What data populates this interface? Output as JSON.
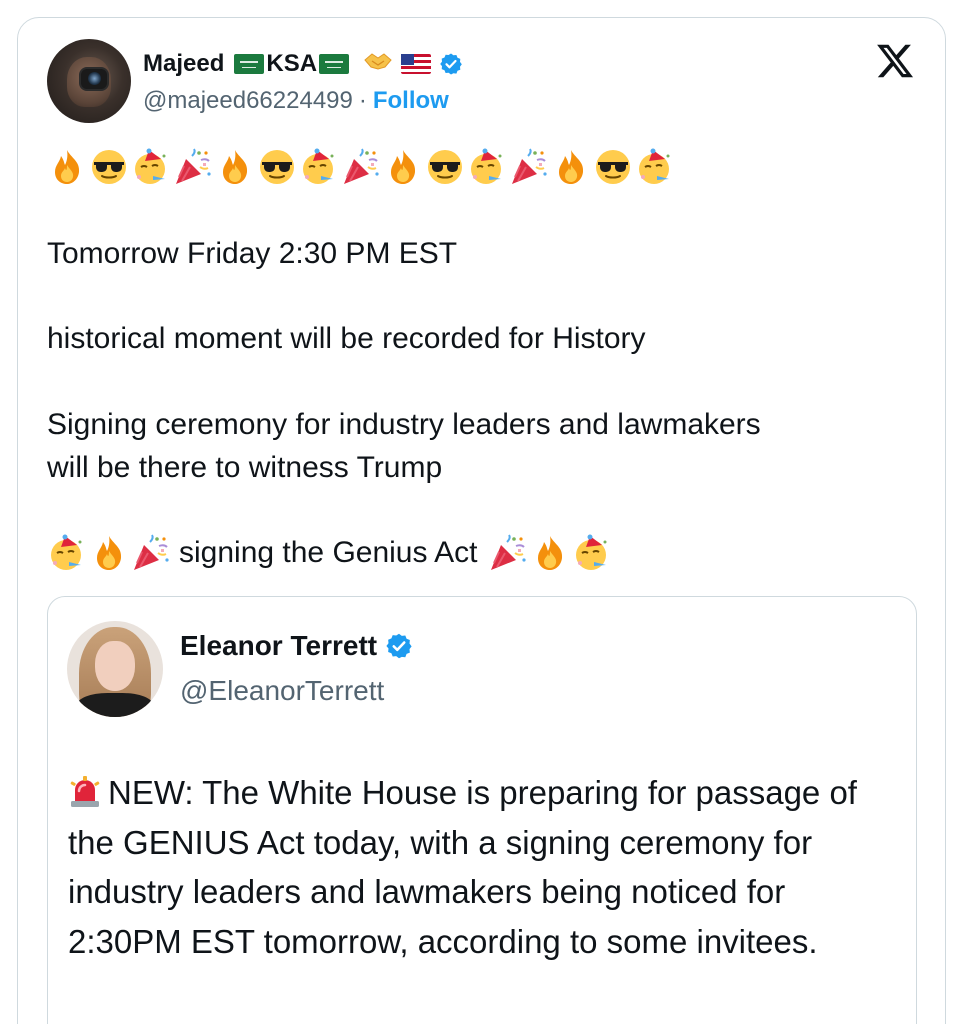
{
  "tweet": {
    "author": {
      "name": "Majeed",
      "name_suffix": "KSA",
      "handle": "@majeed66224499",
      "separator": "·",
      "follow_label": "Follow",
      "verified": true,
      "name_icons": [
        "saudi-flag",
        "saudi-flag",
        "handshake",
        "us-flag",
        "verified-badge"
      ]
    },
    "emoji_sequence": [
      "fire",
      "sunglasses",
      "party-face",
      "party-popper",
      "fire",
      "sunglasses",
      "party-face",
      "party-popper",
      "fire",
      "sunglasses",
      "party-face",
      "party-popper",
      "fire",
      "sunglasses",
      "party-face"
    ],
    "lines": {
      "line1": "Tomorrow Friday 2:30 PM EST",
      "line2": "historical moment will be recorded for History",
      "line3": "Signing ceremony for industry leaders and lawmakers",
      "line4": "will be there to witness Trump",
      "line5": "signing the Genius Act"
    },
    "line5_emojis_before": [
      "party-face",
      "fire",
      "party-popper"
    ],
    "line5_emojis_after": [
      "party-popper",
      "fire",
      "party-face"
    ],
    "platform_logo": "x-logo"
  },
  "quoted_tweet": {
    "author": {
      "name": "Eleanor Terrett",
      "handle": "@EleanorTerrett",
      "verified": true
    },
    "lead_icon": "police-siren",
    "text": "NEW: The White House is preparing for passage of the GENIUS Act today, with a signing ceremony for industry leaders and lawmakers being noticed for 2:30PM EST tomorrow, according to some invitees."
  },
  "colors": {
    "accent": "#1d9bf0",
    "text": "#0f1419",
    "muted": "#536471",
    "border": "#cfd9de"
  }
}
